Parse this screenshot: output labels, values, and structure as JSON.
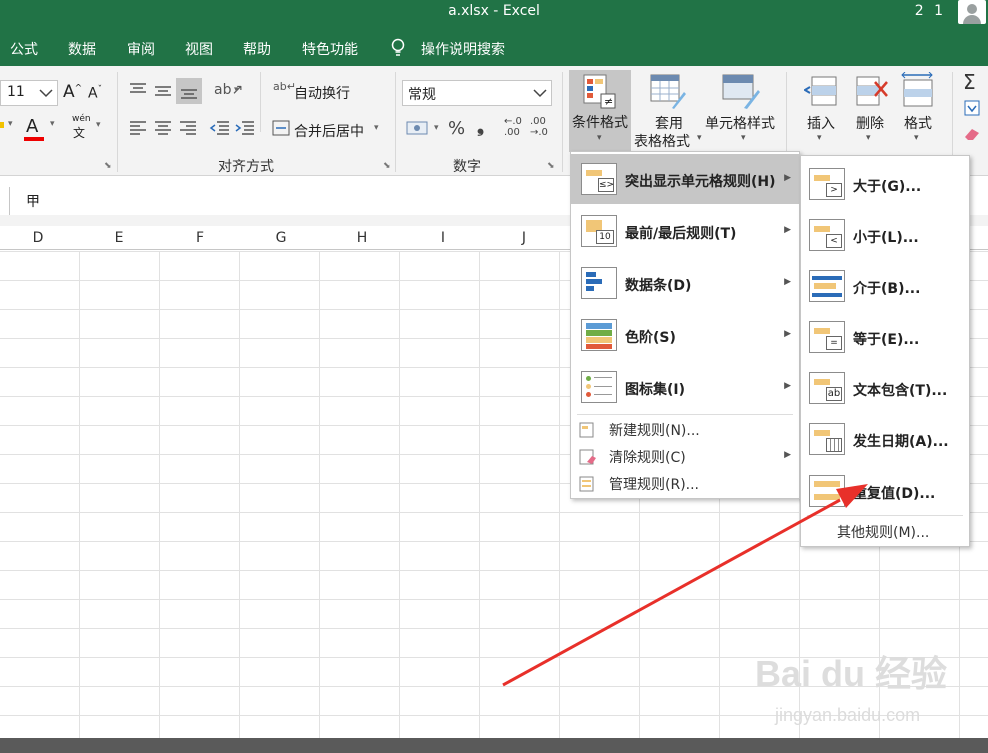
{
  "window": {
    "title": "a.xlsx  -  Excel",
    "user_number": "2 1"
  },
  "menubar": {
    "items": [
      "公式",
      "数据",
      "审阅",
      "视图",
      "帮助",
      "特色功能",
      "操作说明搜索"
    ]
  },
  "ribbon": {
    "font_size": "11",
    "wrap_text": "自动换行",
    "merge_center": "合并后居中",
    "align_group": "对齐方式",
    "number_format": "常规",
    "number_group": "数字",
    "percent": "%",
    "comma": "❟",
    "cond_format": "条件格式",
    "table_format_1": "套用",
    "table_format_2": "表格格式",
    "cell_style": "单元格样式",
    "insert": "插入",
    "delete": "删除",
    "format": "格式",
    "wen": "wén",
    "wen_char": "文",
    "dec_inc": "←.0\n.00",
    "dec_dec": ".00\n→.0"
  },
  "formula_bar": {
    "content": "甲"
  },
  "columns": [
    "D",
    "E",
    "F",
    "G",
    "H",
    "I",
    "J"
  ],
  "cond_menu": {
    "items": [
      {
        "label": "突出显示单元格规则(H)"
      },
      {
        "label": "最前/最后规则(T)",
        "icon_text": "10"
      },
      {
        "label": "数据条(D)"
      },
      {
        "label": "色阶(S)"
      },
      {
        "label": "图标集(I)"
      }
    ],
    "small_items": [
      {
        "label": "新建规则(N)..."
      },
      {
        "label": "清除规则(C)"
      },
      {
        "label": "管理规则(R)..."
      }
    ]
  },
  "sub_menu": {
    "items": [
      {
        "label": "大于(G)...",
        "icon_text": ">"
      },
      {
        "label": "小于(L)...",
        "icon_text": "<"
      },
      {
        "label": "介于(B)..."
      },
      {
        "label": "等于(E)...",
        "icon_text": "="
      },
      {
        "label": "文本包含(T)...",
        "icon_text": "ab"
      },
      {
        "label": "发生日期(A)..."
      },
      {
        "label": "重复值(D)..."
      }
    ],
    "more": "其他规则(M)..."
  },
  "watermark": {
    "text": "Bai du 经验",
    "sub": "jingyan.baidu.com"
  },
  "colors": {
    "excel_green": "#217346",
    "arrow_red": "#e8302a",
    "highlight_gray": "#c6c6c6"
  }
}
